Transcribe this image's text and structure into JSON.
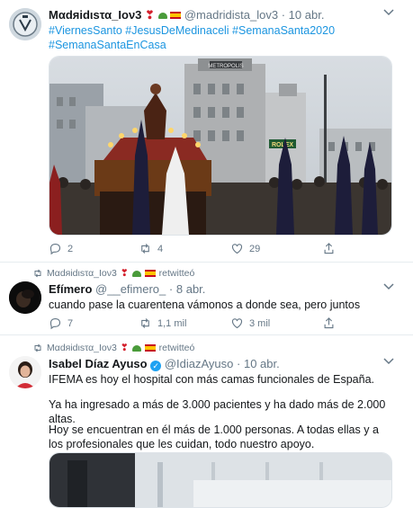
{
  "colors": {
    "link": "#1b95e0",
    "muted": "#657786",
    "divider": "#e6ecf0",
    "verified": "#1da1f2"
  },
  "tweets": [
    {
      "name": "Мαdяidιsτα_Ιον3",
      "handle": "@madridista_lov3",
      "date": "10 abr.",
      "hashtags": "#ViernesSanto #JesusDeMedinaceli #SemanaSanta2020 #SemanaSantaEnCasa",
      "photo_sign_top": "METROPOLIS",
      "photo_sign_rolex": "ROLEX",
      "replies": "2",
      "retweets": "4",
      "likes": "29"
    },
    {
      "retweeted_by": "Мαdяidιsτα_Ιον3",
      "retweeted_label": "retwitteó",
      "name": "Efímero",
      "handle": "@__efimero_",
      "date": "8 abr.",
      "text": "cuando pase la cuarentena vámonos a donde sea, pero juntos",
      "replies": "7",
      "retweets": "1,1 mil",
      "likes": "3 mil"
    },
    {
      "retweeted_by": "Мαdяidιsτα_Ιον3",
      "retweeted_label": "retwitteó",
      "name": "Isabel Díaz Ayuso",
      "handle": "@IdiazAyuso",
      "date": "10 abr.",
      "para1": "IFEMA es hoy el hospital con más camas funcionales de España.",
      "para2": "Ya ha ingresado a más de 3.000 pacientes y ha dado más de 2.000 altas.",
      "para3": "Hoy se encuentran en él más de 1.000 personas. A todas ellas y a los profesionales que les cuidan, todo nuestro apoyo."
    }
  ],
  "separator": "·",
  "verified_mark": "✓"
}
